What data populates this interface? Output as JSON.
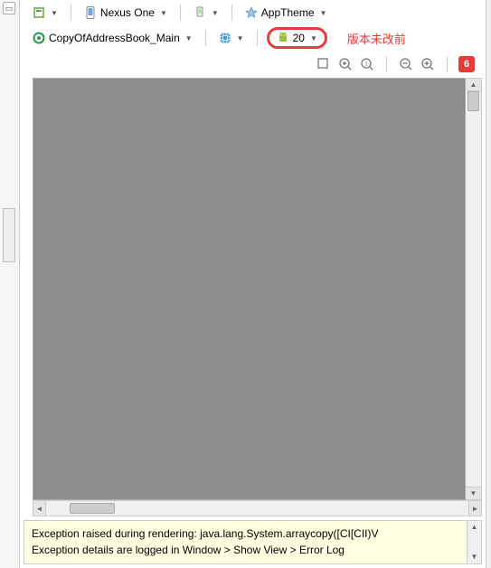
{
  "toolbar1": {
    "device": "Nexus One",
    "theme": "AppTheme"
  },
  "toolbar2": {
    "config": "CopyOfAddressBook_Main",
    "api": "20"
  },
  "annotation": "版本未改前",
  "badge": "6",
  "error": {
    "line1": "Exception raised during rendering: java.lang.System.arraycopy([CI[CII)V",
    "line2": "Exception details are logged in Window > Show View > Error Log"
  }
}
